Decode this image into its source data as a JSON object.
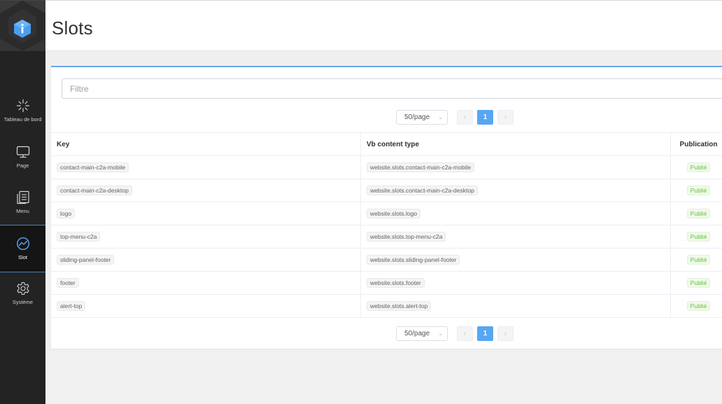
{
  "sidebar": {
    "items": [
      {
        "label": "Tableau de bord",
        "icon": "dashboard-burst-icon"
      },
      {
        "label": "Page",
        "icon": "monitor-icon"
      },
      {
        "label": "Menu",
        "icon": "document-list-icon"
      },
      {
        "label": "Slot",
        "icon": "slot-wave-icon"
      },
      {
        "label": "Système",
        "icon": "gear-icon"
      }
    ],
    "active": "Slot"
  },
  "header": {
    "title": "Slots"
  },
  "filter": {
    "placeholder": "Filtre",
    "value": ""
  },
  "pagination": {
    "page_size": "50/page",
    "current_page": "1",
    "prev": "‹",
    "next": "›",
    "chevron": "⌄"
  },
  "table": {
    "headers": {
      "key": "Key",
      "type": "Vb content type",
      "publication": "Publication"
    },
    "rows": [
      {
        "key": "contact-main-c2a-mobile",
        "type": "website.slots.contact-main-c2a-mobile",
        "status": "Publié"
      },
      {
        "key": "contact-main-c2a-desktop",
        "type": "website.slots.contact-main-c2a-desktop",
        "status": "Publié"
      },
      {
        "key": "logo",
        "type": "website.slots.logo",
        "status": "Publié"
      },
      {
        "key": "top-menu-c2a",
        "type": "website.slots.top-menu-c2a",
        "status": "Publié"
      },
      {
        "key": "sliding-panel-footer",
        "type": "website.slots.sliding-panel-footer",
        "status": "Publié"
      },
      {
        "key": "footer",
        "type": "website.slots.footer",
        "status": "Publié"
      },
      {
        "key": "alert-top",
        "type": "website.slots.alert-top",
        "status": "Publié"
      }
    ]
  },
  "colors": {
    "accent": "#58a6f2",
    "sidebar_bg": "#232323",
    "published": "#67c23a"
  }
}
